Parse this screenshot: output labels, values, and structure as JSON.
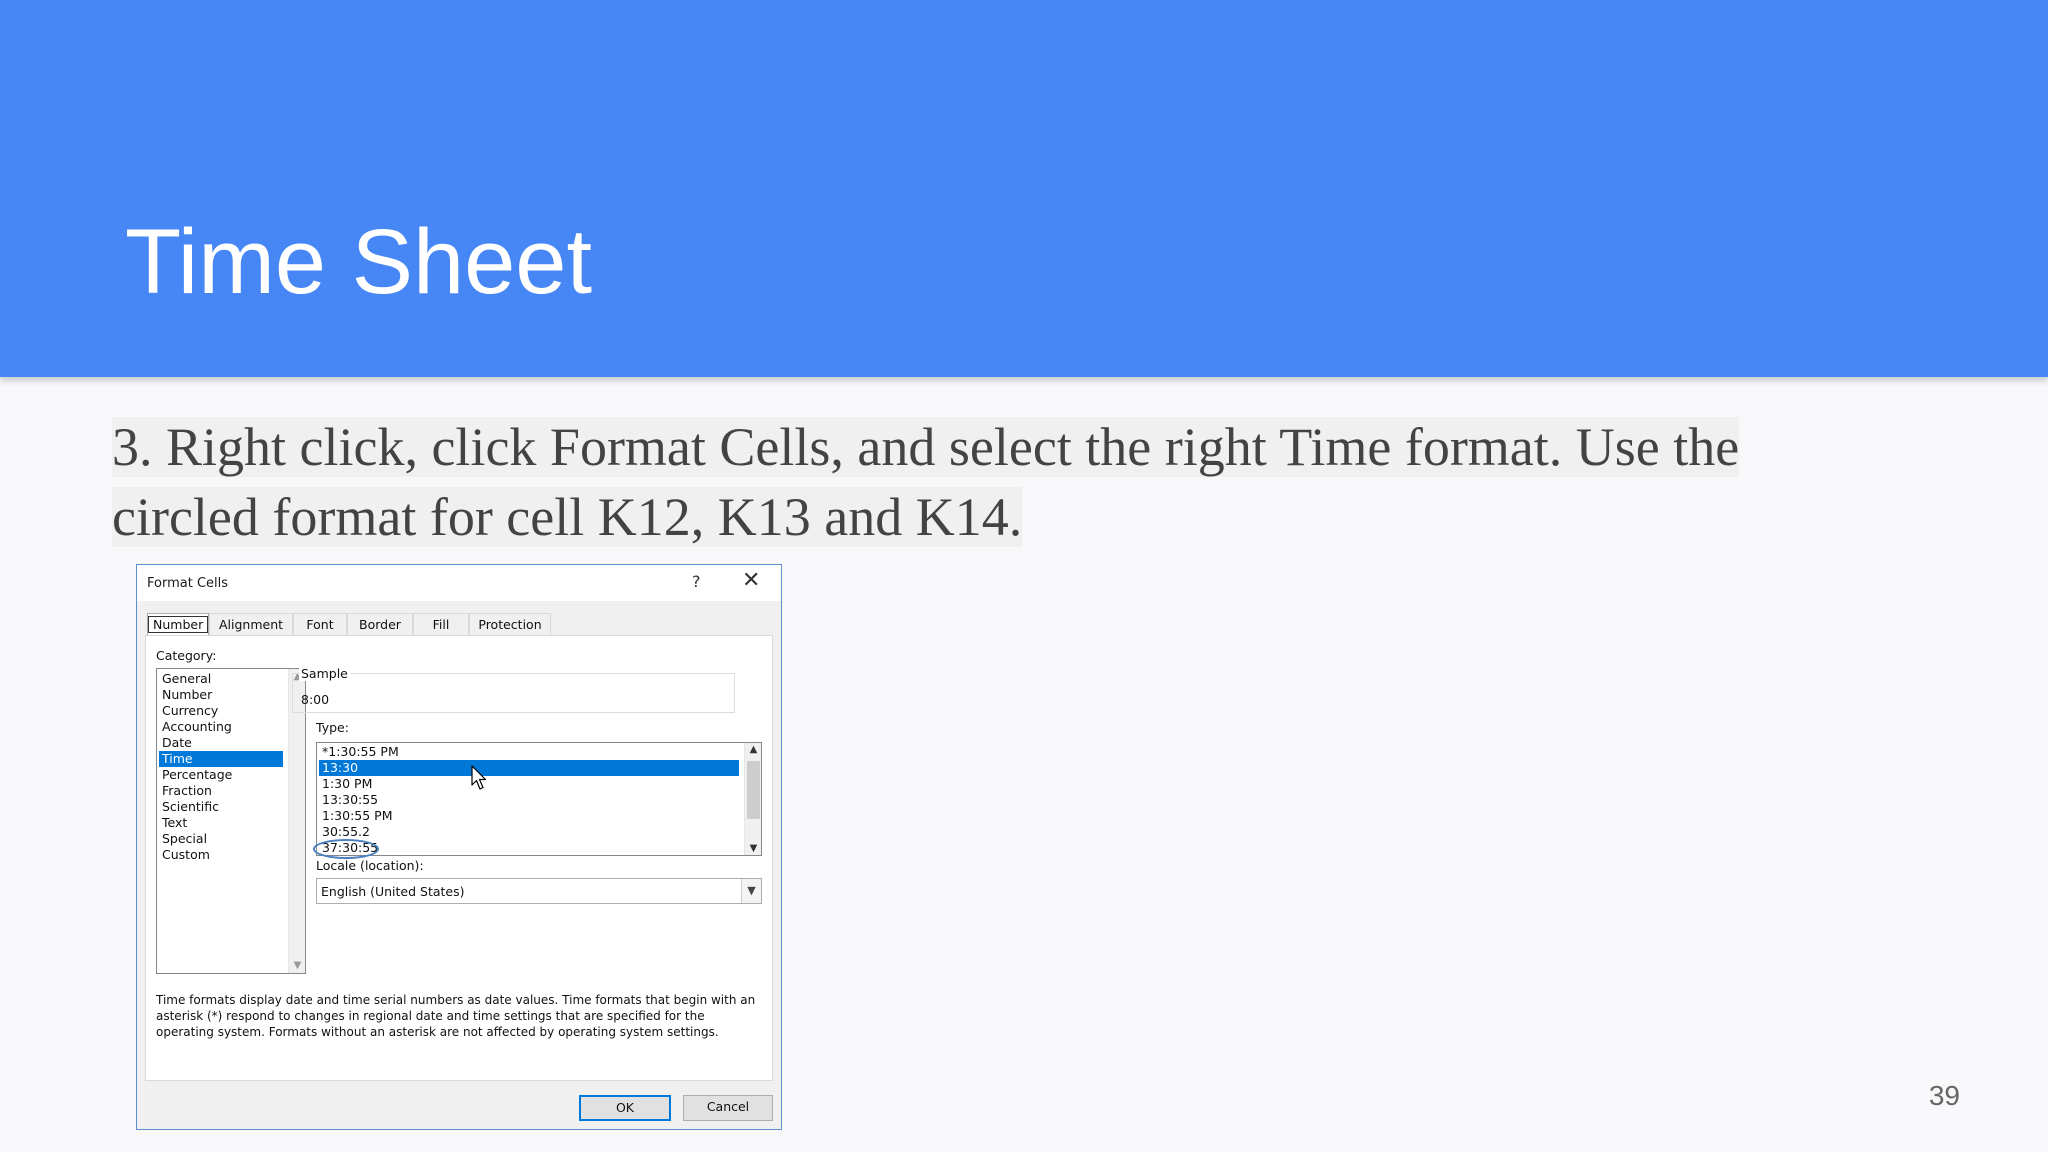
{
  "slide": {
    "title": "Time Sheet",
    "instruction_line1": "3. Right click, click Format Cells, and select the right Time format. Use the",
    "instruction_line2": "circled format for cell K12, K13 and K14.",
    "page_number": "39"
  },
  "dialog": {
    "title": "Format Cells",
    "help_glyph": "?",
    "close_glyph": "✕",
    "tabs": [
      "Number",
      "Alignment",
      "Font",
      "Border",
      "Fill",
      "Protection"
    ],
    "active_tab": "Number",
    "category_label": "Category:",
    "categories": [
      "General",
      "Number",
      "Currency",
      "Accounting",
      "Date",
      "Time",
      "Percentage",
      "Fraction",
      "Scientific",
      "Text",
      "Special",
      "Custom"
    ],
    "selected_category": "Time",
    "sample_label": "Sample",
    "sample_value": "8:00",
    "type_label": "Type:",
    "types": [
      "*1:30:55 PM",
      "13:30",
      "1:30 PM",
      "13:30:55",
      "1:30:55 PM",
      "30:55.2",
      "37:30:55"
    ],
    "selected_type": "13:30",
    "circled_type": "37:30:55",
    "locale_label": "Locale (location):",
    "locale_value": "English (United States)",
    "description": "Time formats display date and time serial numbers as date values.  Time formats that begin with an asterisk (*) respond to changes in regional date and time settings that are specified for the operating system. Formats without an asterisk are not affected by operating system settings.",
    "ok_label": "OK",
    "cancel_label": "Cancel"
  },
  "colors": {
    "header_blue": "#4686f5",
    "selection_blue": "#0078d7",
    "annotation_circle": "#4a7fc0"
  }
}
